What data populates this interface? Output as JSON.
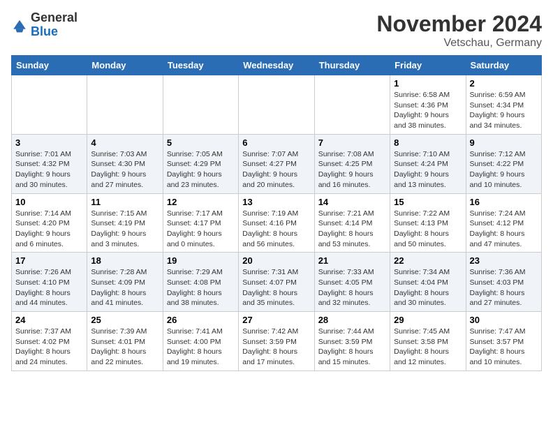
{
  "header": {
    "logo_general": "General",
    "logo_blue": "Blue",
    "month_title": "November 2024",
    "location": "Vetschau, Germany"
  },
  "weekdays": [
    "Sunday",
    "Monday",
    "Tuesday",
    "Wednesday",
    "Thursday",
    "Friday",
    "Saturday"
  ],
  "weeks": [
    [
      {
        "day": "",
        "sunrise": "",
        "sunset": "",
        "daylight": ""
      },
      {
        "day": "",
        "sunrise": "",
        "sunset": "",
        "daylight": ""
      },
      {
        "day": "",
        "sunrise": "",
        "sunset": "",
        "daylight": ""
      },
      {
        "day": "",
        "sunrise": "",
        "sunset": "",
        "daylight": ""
      },
      {
        "day": "",
        "sunrise": "",
        "sunset": "",
        "daylight": ""
      },
      {
        "day": "1",
        "sunrise": "Sunrise: 6:58 AM",
        "sunset": "Sunset: 4:36 PM",
        "daylight": "Daylight: 9 hours and 38 minutes."
      },
      {
        "day": "2",
        "sunrise": "Sunrise: 6:59 AM",
        "sunset": "Sunset: 4:34 PM",
        "daylight": "Daylight: 9 hours and 34 minutes."
      }
    ],
    [
      {
        "day": "3",
        "sunrise": "Sunrise: 7:01 AM",
        "sunset": "Sunset: 4:32 PM",
        "daylight": "Daylight: 9 hours and 30 minutes."
      },
      {
        "day": "4",
        "sunrise": "Sunrise: 7:03 AM",
        "sunset": "Sunset: 4:30 PM",
        "daylight": "Daylight: 9 hours and 27 minutes."
      },
      {
        "day": "5",
        "sunrise": "Sunrise: 7:05 AM",
        "sunset": "Sunset: 4:29 PM",
        "daylight": "Daylight: 9 hours and 23 minutes."
      },
      {
        "day": "6",
        "sunrise": "Sunrise: 7:07 AM",
        "sunset": "Sunset: 4:27 PM",
        "daylight": "Daylight: 9 hours and 20 minutes."
      },
      {
        "day": "7",
        "sunrise": "Sunrise: 7:08 AM",
        "sunset": "Sunset: 4:25 PM",
        "daylight": "Daylight: 9 hours and 16 minutes."
      },
      {
        "day": "8",
        "sunrise": "Sunrise: 7:10 AM",
        "sunset": "Sunset: 4:24 PM",
        "daylight": "Daylight: 9 hours and 13 minutes."
      },
      {
        "day": "9",
        "sunrise": "Sunrise: 7:12 AM",
        "sunset": "Sunset: 4:22 PM",
        "daylight": "Daylight: 9 hours and 10 minutes."
      }
    ],
    [
      {
        "day": "10",
        "sunrise": "Sunrise: 7:14 AM",
        "sunset": "Sunset: 4:20 PM",
        "daylight": "Daylight: 9 hours and 6 minutes."
      },
      {
        "day": "11",
        "sunrise": "Sunrise: 7:15 AM",
        "sunset": "Sunset: 4:19 PM",
        "daylight": "Daylight: 9 hours and 3 minutes."
      },
      {
        "day": "12",
        "sunrise": "Sunrise: 7:17 AM",
        "sunset": "Sunset: 4:17 PM",
        "daylight": "Daylight: 9 hours and 0 minutes."
      },
      {
        "day": "13",
        "sunrise": "Sunrise: 7:19 AM",
        "sunset": "Sunset: 4:16 PM",
        "daylight": "Daylight: 8 hours and 56 minutes."
      },
      {
        "day": "14",
        "sunrise": "Sunrise: 7:21 AM",
        "sunset": "Sunset: 4:14 PM",
        "daylight": "Daylight: 8 hours and 53 minutes."
      },
      {
        "day": "15",
        "sunrise": "Sunrise: 7:22 AM",
        "sunset": "Sunset: 4:13 PM",
        "daylight": "Daylight: 8 hours and 50 minutes."
      },
      {
        "day": "16",
        "sunrise": "Sunrise: 7:24 AM",
        "sunset": "Sunset: 4:12 PM",
        "daylight": "Daylight: 8 hours and 47 minutes."
      }
    ],
    [
      {
        "day": "17",
        "sunrise": "Sunrise: 7:26 AM",
        "sunset": "Sunset: 4:10 PM",
        "daylight": "Daylight: 8 hours and 44 minutes."
      },
      {
        "day": "18",
        "sunrise": "Sunrise: 7:28 AM",
        "sunset": "Sunset: 4:09 PM",
        "daylight": "Daylight: 8 hours and 41 minutes."
      },
      {
        "day": "19",
        "sunrise": "Sunrise: 7:29 AM",
        "sunset": "Sunset: 4:08 PM",
        "daylight": "Daylight: 8 hours and 38 minutes."
      },
      {
        "day": "20",
        "sunrise": "Sunrise: 7:31 AM",
        "sunset": "Sunset: 4:07 PM",
        "daylight": "Daylight: 8 hours and 35 minutes."
      },
      {
        "day": "21",
        "sunrise": "Sunrise: 7:33 AM",
        "sunset": "Sunset: 4:05 PM",
        "daylight": "Daylight: 8 hours and 32 minutes."
      },
      {
        "day": "22",
        "sunrise": "Sunrise: 7:34 AM",
        "sunset": "Sunset: 4:04 PM",
        "daylight": "Daylight: 8 hours and 30 minutes."
      },
      {
        "day": "23",
        "sunrise": "Sunrise: 7:36 AM",
        "sunset": "Sunset: 4:03 PM",
        "daylight": "Daylight: 8 hours and 27 minutes."
      }
    ],
    [
      {
        "day": "24",
        "sunrise": "Sunrise: 7:37 AM",
        "sunset": "Sunset: 4:02 PM",
        "daylight": "Daylight: 8 hours and 24 minutes."
      },
      {
        "day": "25",
        "sunrise": "Sunrise: 7:39 AM",
        "sunset": "Sunset: 4:01 PM",
        "daylight": "Daylight: 8 hours and 22 minutes."
      },
      {
        "day": "26",
        "sunrise": "Sunrise: 7:41 AM",
        "sunset": "Sunset: 4:00 PM",
        "daylight": "Daylight: 8 hours and 19 minutes."
      },
      {
        "day": "27",
        "sunrise": "Sunrise: 7:42 AM",
        "sunset": "Sunset: 3:59 PM",
        "daylight": "Daylight: 8 hours and 17 minutes."
      },
      {
        "day": "28",
        "sunrise": "Sunrise: 7:44 AM",
        "sunset": "Sunset: 3:59 PM",
        "daylight": "Daylight: 8 hours and 15 minutes."
      },
      {
        "day": "29",
        "sunrise": "Sunrise: 7:45 AM",
        "sunset": "Sunset: 3:58 PM",
        "daylight": "Daylight: 8 hours and 12 minutes."
      },
      {
        "day": "30",
        "sunrise": "Sunrise: 7:47 AM",
        "sunset": "Sunset: 3:57 PM",
        "daylight": "Daylight: 8 hours and 10 minutes."
      }
    ]
  ]
}
